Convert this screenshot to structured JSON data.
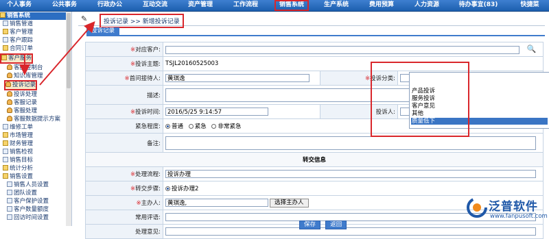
{
  "topnav": {
    "items": [
      {
        "label": "个人事务"
      },
      {
        "label": "公共事务"
      },
      {
        "label": "行政办公"
      },
      {
        "label": "互动交流"
      },
      {
        "label": "资产管理"
      },
      {
        "label": "工作流程"
      },
      {
        "label": "销售系统"
      },
      {
        "label": "生产系统"
      },
      {
        "label": "费用预算"
      },
      {
        "label": "人力资源"
      },
      {
        "label": "待办事宜(83)"
      },
      {
        "label": "快捷菜"
      }
    ]
  },
  "sidebar": {
    "items": [
      {
        "label": "销售系统"
      },
      {
        "label": "销售管道"
      },
      {
        "label": "客户管理"
      },
      {
        "label": "客户跟踪"
      },
      {
        "label": "合同订单"
      },
      {
        "label": "客户服务"
      },
      {
        "label": "客服控制台"
      },
      {
        "label": "知识库管理"
      },
      {
        "label": "投诉记录"
      },
      {
        "label": "投诉处理"
      },
      {
        "label": "客服记录"
      },
      {
        "label": "客服处理"
      },
      {
        "label": "客服数据提示方案"
      },
      {
        "label": "维修工单"
      },
      {
        "label": "市场管理"
      },
      {
        "label": "财务管理"
      },
      {
        "label": "销售检视"
      },
      {
        "label": "销售目标"
      },
      {
        "label": "统计分析"
      },
      {
        "label": "销售设置"
      },
      {
        "label": "销售人员设置"
      },
      {
        "label": "团队设置"
      },
      {
        "label": "客户保护设置"
      },
      {
        "label": "客户数量额度"
      },
      {
        "label": "回访时间设置"
      }
    ]
  },
  "breadcrumb": {
    "text": "投诉记录 >> 新增投诉记录"
  },
  "tab": {
    "label": "投诉记录"
  },
  "form": {
    "customer_label": "对应客户:",
    "subject_label": "投诉主题:",
    "subject_value": "TSJL20160525003",
    "receiver_label": "首问接待人:",
    "receiver_value": "黄琪逸",
    "category_label": "投诉分类:",
    "describe_label": "描述:",
    "time_label": "投诉时间:",
    "time_value": "2016/5/25 9:14:57",
    "complainant_label": "投诉人:",
    "urgency_label": "紧急程度:",
    "urgency_options": [
      "普通",
      "紧急",
      "非常紧急"
    ],
    "remark_label": "备注:",
    "section_title": "转交信息",
    "process_label": "处理流程:",
    "process_value": "投诉办理",
    "step_label": "转交步骤:",
    "step_value": "投诉办理2",
    "host_label": "主办人:",
    "host_value": "黄琪逸,",
    "select_host_button": "选择主办人",
    "common_comments_label": "常用评语:",
    "opinion_label": "处理意见:"
  },
  "category_dropdown": {
    "options": [
      "产品投诉",
      "服务投诉",
      "客户意见",
      "其他",
      "质量低下"
    ],
    "selected": "质量低下"
  },
  "buttons": {
    "save": "保存",
    "back": "返回"
  },
  "logo": {
    "brand": "泛普软件",
    "url": "www.fanpusoft.com"
  },
  "colors": {
    "nav_blue": "#1d5fae",
    "highlight_red": "#d9262b",
    "selected_blue": "#3a75c4"
  }
}
